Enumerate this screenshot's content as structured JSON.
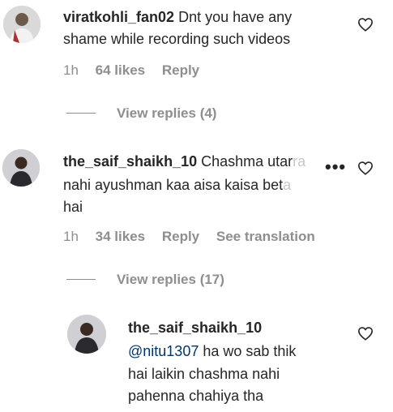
{
  "comments": [
    {
      "username": "viratkohli_fan02",
      "text_line1": "Dnt you have any",
      "text_line2": "shame while recording such videos",
      "time": "1h",
      "likes": "64 likes",
      "reply": "Reply",
      "view_replies": "View replies (4)"
    },
    {
      "username": "the_saif_shaikh_10",
      "text_line1_a": "Chashma utar",
      "text_line1_b": "ra",
      "text_line2_a": "nahi ayushman kaa aisa kaisa bet",
      "text_line2_b": "a",
      "text_line3": "hai",
      "time": "1h",
      "likes": "34 likes",
      "reply": "Reply",
      "see_translation": "See translation",
      "view_replies": "View replies (17)"
    }
  ],
  "reply": {
    "username": "the_saif_shaikh_10",
    "mention": "@nitu1307",
    "text_line1": " ha wo sab thik",
    "text_line2": "hai laikin chashma nahi",
    "text_line3": "pahenna chahiya tha"
  },
  "icons": {
    "heart": "heart-outline-icon",
    "more": "more-options-icon"
  },
  "more_symbol": "•••"
}
